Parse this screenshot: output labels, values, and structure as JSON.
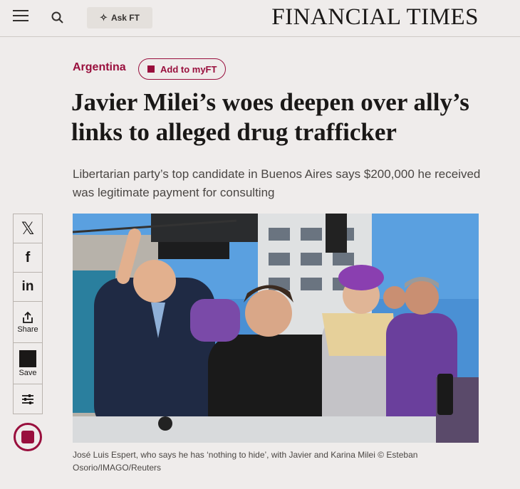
{
  "header": {
    "ask_label": "Ask FT",
    "masthead": "FINANCIAL TIMES"
  },
  "article": {
    "topic": "Argentina",
    "myft_label": "Add to myFT",
    "headline": "Javier Milei’s woes deepen over ally’s links to alleged drug trafficker",
    "standfirst": "Libertarian party’s top candidate in Buenos Aires says $200,000 he received was legitimate payment for consulting",
    "caption": "José Luis Espert, who says he has ‘nothing to hide’, with Javier and Karina Milei © Esteban Osorio/IMAGO/Reuters"
  },
  "share": {
    "x_glyph": "𝕏",
    "facebook_glyph": "f",
    "linkedin_glyph": "in",
    "share_label": "Share",
    "save_label": "Save"
  },
  "colors": {
    "accent": "#990f3d",
    "background": "#efeceb",
    "text": "#33302e"
  }
}
